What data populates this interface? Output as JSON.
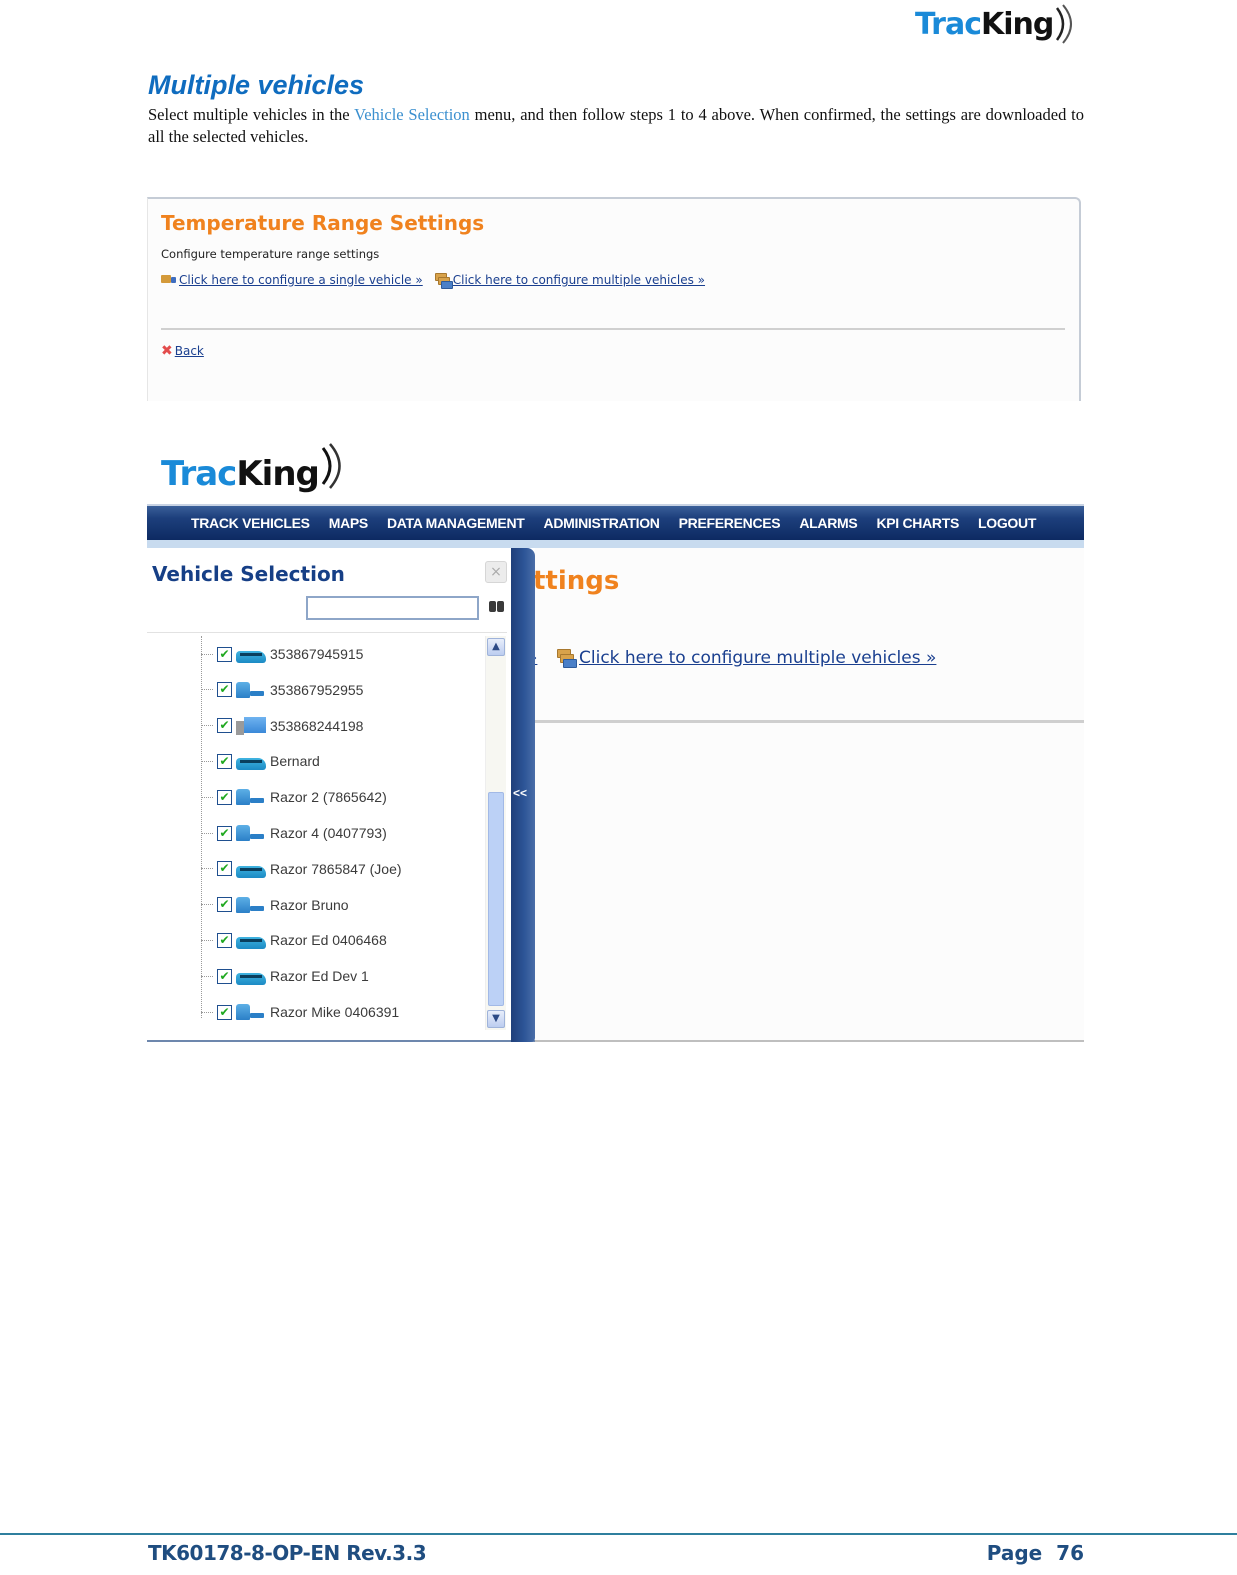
{
  "header": {
    "logo": {
      "part1": "Trac",
      "part2": "King",
      "icon": "signal-waves-icon"
    }
  },
  "section": {
    "title": "Multiple vehicles",
    "body_before": "Select multiple vehicles in the ",
    "body_highlight": "Vehicle Selection",
    "body_after": " menu, and then follow steps 1 to 4 above. When confirmed, the settings are downloaded to all the selected vehicles."
  },
  "screenshot1": {
    "title": "Temperature Range Settings",
    "description": "Configure temperature range settings",
    "single_link": "Click here to configure a single vehicle »",
    "multiple_link": "Click here to configure multiple vehicles »",
    "back_link": "Back",
    "colors": {
      "title": "#f0821e",
      "link": "#1a3f8f"
    }
  },
  "screenshot2": {
    "logo": {
      "part1": "Trac",
      "part2": "King"
    },
    "nav": [
      "TRACK VEHICLES",
      "MAPS",
      "DATA MANAGEMENT",
      "ADMINISTRATION",
      "PREFERENCES",
      "ALARMS",
      "KPI CHARTS",
      "LOGOUT"
    ],
    "main": {
      "title_fragment": "ttings",
      "link_fragment": "»",
      "multiple_link": "Click here to configure multiple vehicles »"
    },
    "panel": {
      "title": "Vehicle Selection",
      "close_icon": "×",
      "search_value": "",
      "search_placeholder": "",
      "collapse_label": "<<",
      "scroll_up": "▲",
      "scroll_down": "▼",
      "vehicles": [
        {
          "label": "353867945915",
          "type": "bus",
          "checked": true
        },
        {
          "label": "353867952955",
          "type": "tractor",
          "checked": true
        },
        {
          "label": "353868244198",
          "type": "truck",
          "checked": true
        },
        {
          "label": "Bernard",
          "type": "bus",
          "checked": true
        },
        {
          "label": "Razor 2 (7865642)",
          "type": "tractor",
          "checked": true
        },
        {
          "label": "Razor 4 (0407793)",
          "type": "tractor",
          "checked": true
        },
        {
          "label": "Razor 7865847 (Joe)",
          "type": "bus",
          "checked": true
        },
        {
          "label": "Razor Bruno",
          "type": "tractor",
          "checked": true
        },
        {
          "label": "Razor Ed 0406468",
          "type": "bus",
          "checked": true
        },
        {
          "label": "Razor Ed Dev 1",
          "type": "bus",
          "checked": true
        },
        {
          "label": "Razor Mike 0406391",
          "type": "tractor",
          "checked": true
        }
      ],
      "check_mark": "✔"
    }
  },
  "footer": {
    "doc_id": "TK60178-8-OP-EN Rev.3.3",
    "page_label": "Page  76"
  }
}
